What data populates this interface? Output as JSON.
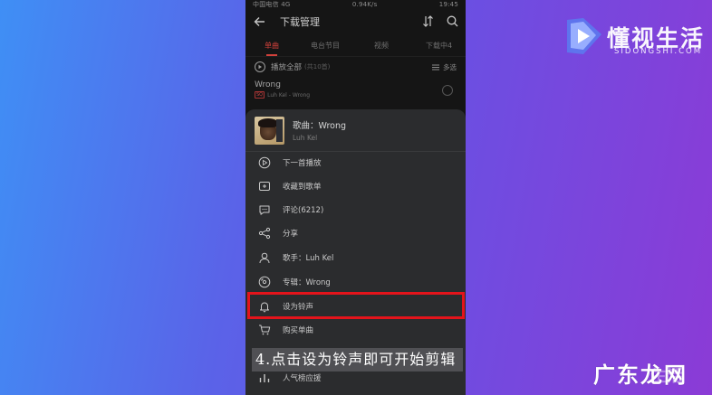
{
  "status_bar": {
    "left": "中国电信 4G",
    "speed": "0.94K/s",
    "time": "19:45"
  },
  "app_bar": {
    "title": "下载管理"
  },
  "tabs": [
    "单曲",
    "电台节目",
    "视频",
    "下载中4"
  ],
  "play_all": {
    "label": "播放全部",
    "count": "(共10首)",
    "multi_select": "多选"
  },
  "song": {
    "name": "Wrong",
    "sub": "Luh Kel - Wrong",
    "tag": "SQ"
  },
  "sheet": {
    "title": "歌曲：Wrong",
    "artist": "Luh Kel",
    "items": [
      {
        "icon": "play-next-icon",
        "label": "下一首播放"
      },
      {
        "icon": "add-to-playlist-icon",
        "label": "收藏到歌单"
      },
      {
        "icon": "comment-icon",
        "label": "评论(6212)"
      },
      {
        "icon": "share-icon",
        "label": "分享"
      },
      {
        "icon": "artist-icon",
        "label": "歌手：Luh Kel"
      },
      {
        "icon": "album-icon",
        "label": "专辑：Wrong"
      },
      {
        "icon": "bell-icon",
        "label": "设为铃声"
      },
      {
        "icon": "cart-icon",
        "label": "购买单曲"
      },
      {
        "icon": "chart-icon",
        "label": "人气榜应援"
      }
    ]
  },
  "caption": "4.点击设为铃声即可开始剪辑",
  "logo": {
    "cn": "懂视生活",
    "en": "SIDONGSHI.COM"
  },
  "watermark": {
    "text": "广东龙网",
    "faint": "生活"
  },
  "colors": {
    "accent": "#d2413b",
    "highlight": "#e4141b",
    "sheet_bg": "#2b2c2e"
  }
}
